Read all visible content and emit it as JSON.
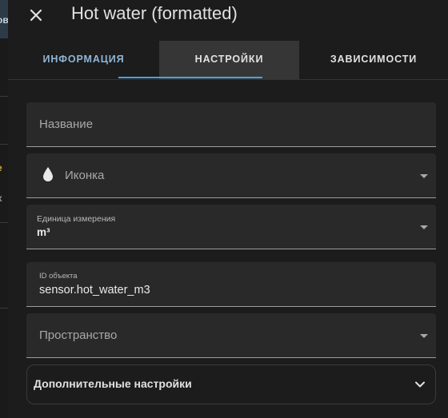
{
  "backdrop": {
    "fragments": [
      "ов",
      "е",
      "х"
    ]
  },
  "header": {
    "title": "Hot water (formatted)",
    "close_icon": "close-icon"
  },
  "tabs": [
    {
      "label": "Информация",
      "active": false
    },
    {
      "label": "Настройки",
      "active": true
    },
    {
      "label": "Зависимости",
      "active": false
    }
  ],
  "form": {
    "name": {
      "placeholder": "Название",
      "value": ""
    },
    "icon": {
      "placeholder": "Иконка",
      "icon": "water-drop-icon"
    },
    "unit": {
      "label": "Единица измерения",
      "value": "m³"
    },
    "entity_id": {
      "label": "ID объекта",
      "value": "sensor.hot_water_m3"
    },
    "area": {
      "placeholder": "Пространство"
    }
  },
  "advanced": {
    "label": "Дополнительные настройки",
    "icon": "chevron-down-icon"
  },
  "colors": {
    "accent": "#4aa3df",
    "background": "#1c1c1c",
    "field_background": "#292929"
  }
}
